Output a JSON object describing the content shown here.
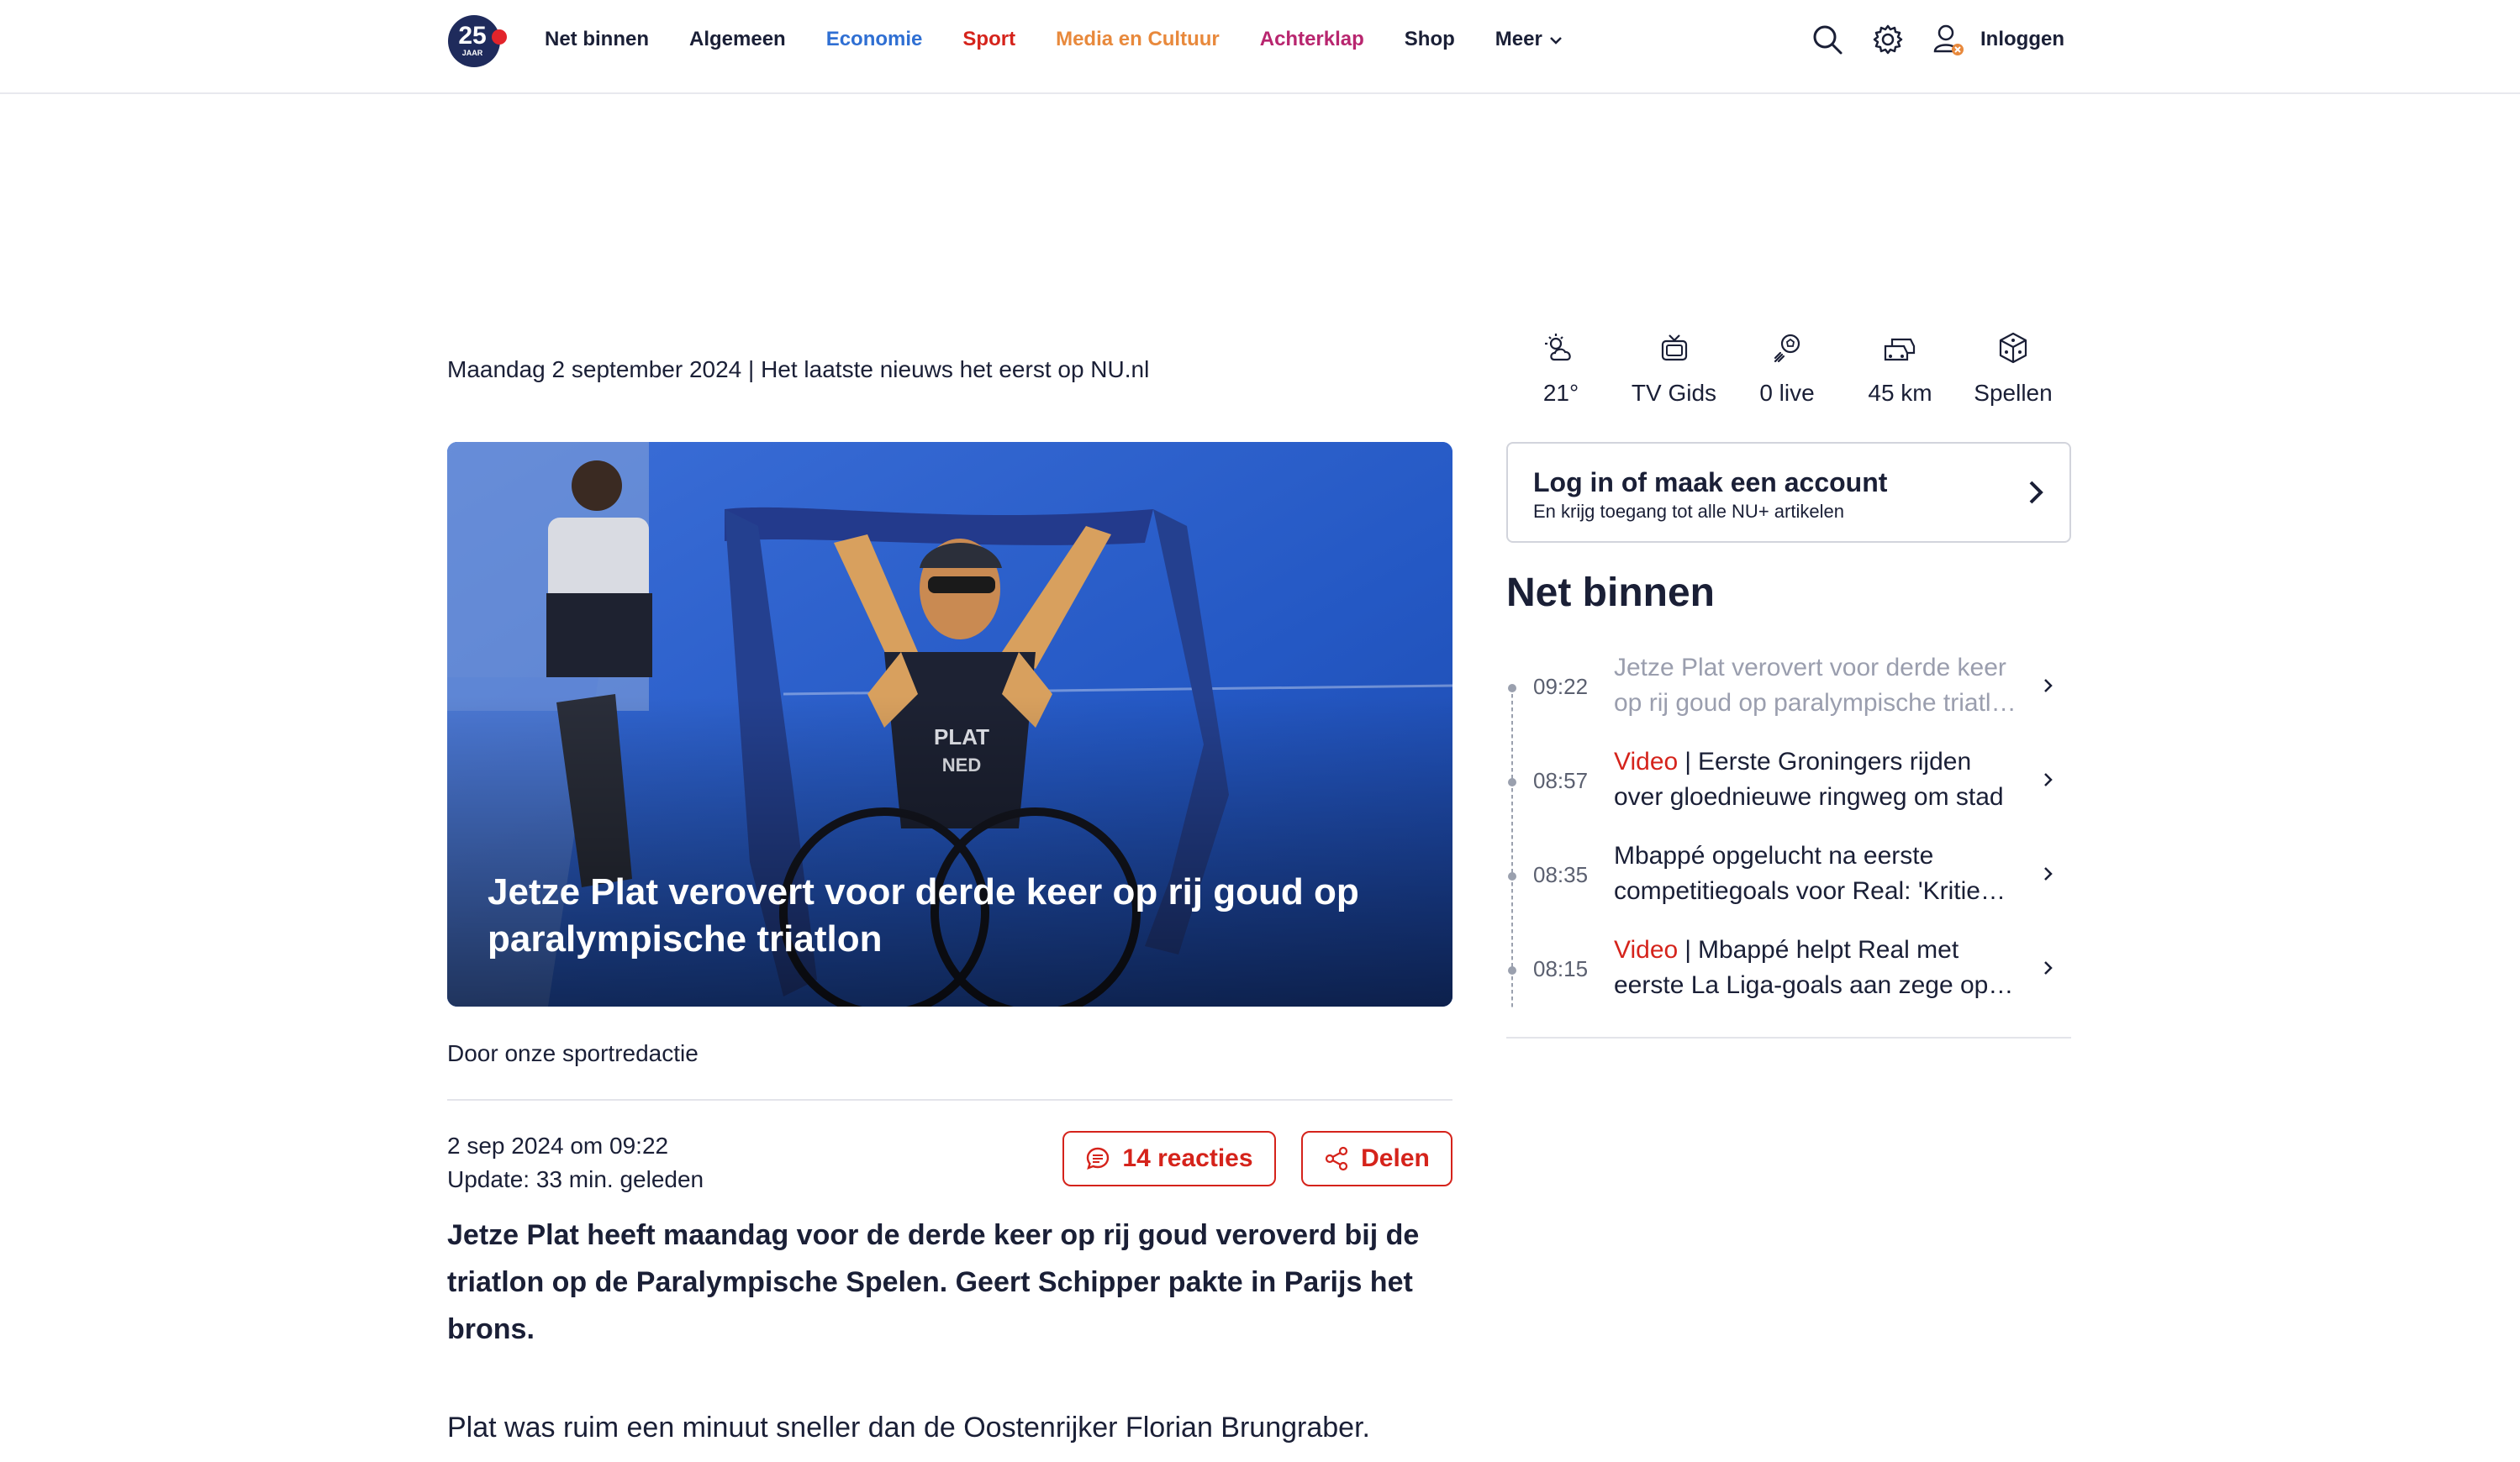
{
  "header": {
    "logo_text": "25",
    "logo_sub": "JAAR",
    "nav": [
      {
        "label": "Net binnen",
        "color": "#1a1f36"
      },
      {
        "label": "Algemeen",
        "color": "#1a1f36"
      },
      {
        "label": "Economie",
        "color": "#2f6fd3"
      },
      {
        "label": "Sport",
        "color": "#d5231b"
      },
      {
        "label": "Media en Cultuur",
        "color": "#e8893c"
      },
      {
        "label": "Achterklap",
        "color": "#b8266f"
      },
      {
        "label": "Shop",
        "color": "#1a1f36"
      },
      {
        "label": "Meer",
        "color": "#1a1f36"
      }
    ],
    "login_label": "Inloggen",
    "icons": [
      "search-icon",
      "gear-icon",
      "user-icon"
    ]
  },
  "dateline": "Maandag 2 september 2024 | Het laatste nieuws het eerst op NU.nl",
  "article": {
    "hero_title": "Jetze Plat verovert voor derde keer op rij goud op paralympische triatlon",
    "byline": "Door onze sportredactie",
    "date": "2 sep 2024 om 09:22",
    "update": "Update: 33 min. geleden",
    "reactions_label": "14 reacties",
    "share_label": "Delen",
    "lead": "Jetze Plat heeft maandag voor de derde keer op rij goud veroverd bij de triatlon op de Paralympische Spelen. Geert Schipper pakte in Parijs het brons.",
    "body_first": "Plat was ruim een minuut sneller dan de Oostenrijker Florian Brungraber.",
    "accent_color": "#d5231b"
  },
  "quicklinks": [
    {
      "icon": "weather-icon",
      "label": "21°"
    },
    {
      "icon": "tv-icon",
      "label": "TV Gids"
    },
    {
      "icon": "live-ball-icon",
      "label": "0 live"
    },
    {
      "icon": "traffic-icon",
      "label": "45 km"
    },
    {
      "icon": "dice-icon",
      "label": "Spellen"
    }
  ],
  "account": {
    "title": "Log in of maak een account",
    "subtitle": "En krijg toegang tot alle NU+ artikelen"
  },
  "net_binnen": {
    "title": "Net binnen",
    "items": [
      {
        "time": "09:22",
        "tag": "",
        "line1": "Jetze Plat verovert voor derde keer",
        "line2": "op rij goud op paralympische triatlon",
        "read": true
      },
      {
        "time": "08:57",
        "tag": "Video",
        "line1": "Eerste Groningers rijden",
        "line2": "over gloednieuwe ringweg om stad",
        "read": false
      },
      {
        "time": "08:35",
        "tag": "",
        "line1": "Mbappé opgelucht na eerste",
        "line2": "competitiegoals voor Real: 'Kritiek…",
        "read": false
      },
      {
        "time": "08:15",
        "tag": "Video",
        "line1": "Mbappé helpt Real met",
        "line2": "eerste La Liga-goals aan zege op…",
        "read": false
      }
    ]
  }
}
